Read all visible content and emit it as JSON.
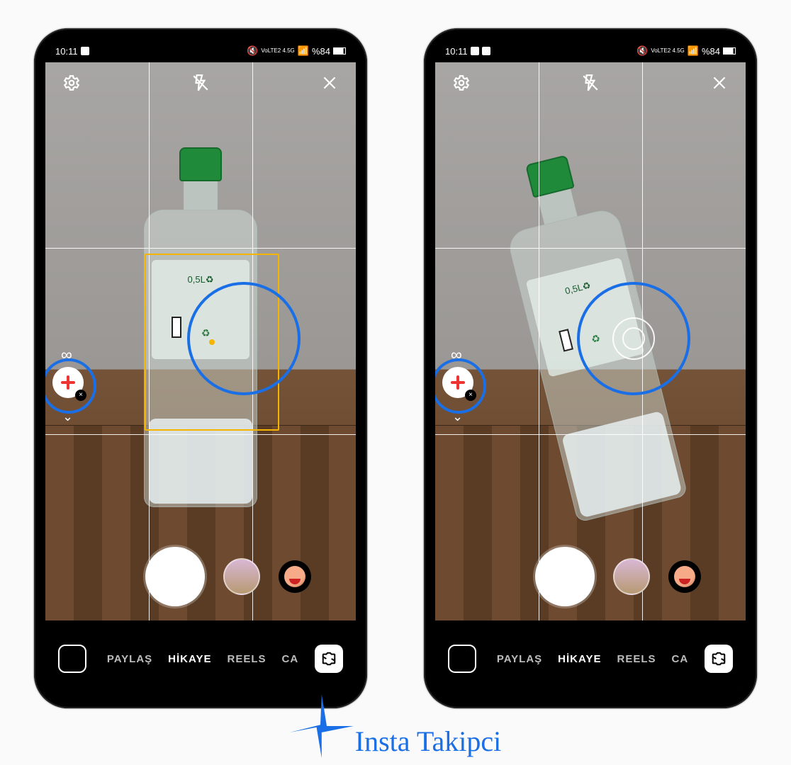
{
  "statusbar": {
    "time": "10:11",
    "network_label": "VoLTE2 4.5G",
    "battery_text": "%84",
    "has_image_notif_left": false
  },
  "statusbar_right_phone": {
    "time": "10:11",
    "network_label": "VoLTE2 4.5G",
    "battery_text": "%84",
    "has_image_notif_left": true
  },
  "viewport": {
    "grid_enabled": true,
    "bottle_volume_text": "0,5L♻"
  },
  "left_phone": {
    "focus_rect_visible": true,
    "tilt_circle_visible": false
  },
  "right_phone": {
    "focus_rect_visible": false,
    "tilt_circle_visible": true
  },
  "top_controls": {
    "settings_icon": "gear",
    "flash_icon": "flash-off",
    "close_icon": "close"
  },
  "effect_sidebar": {
    "infinity_symbol": "∞",
    "chevron_symbol": "⌄",
    "close_badge": "×"
  },
  "mode_bar": {
    "modes": [
      "PAYLAŞ",
      "HİKAYE",
      "REELS",
      "CA"
    ],
    "active_index": 1
  },
  "watermark": {
    "text": "Insta Takipci"
  },
  "colors": {
    "annotation_blue": "#1a6fe6",
    "focus_yellow": "#f4b400",
    "cap_green": "#1e8a3a"
  }
}
